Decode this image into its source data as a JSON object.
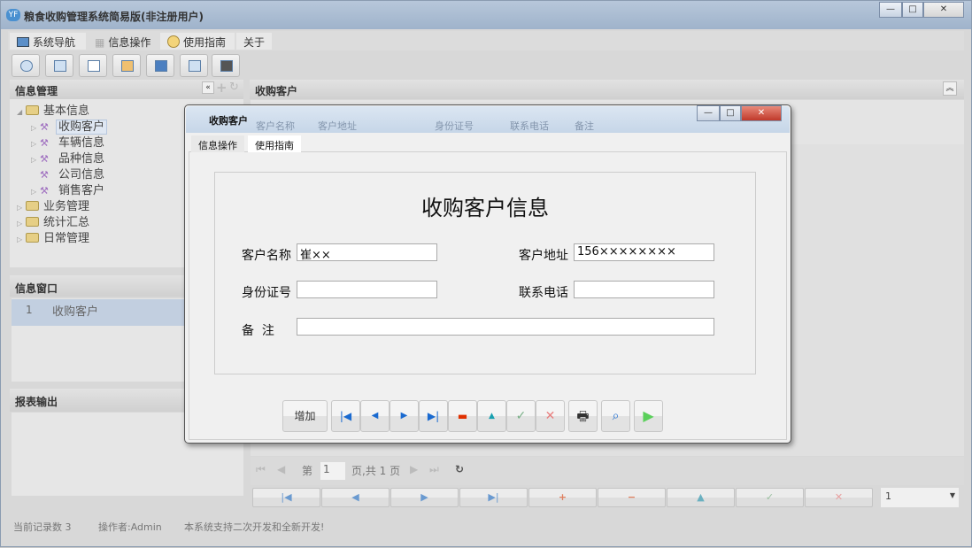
{
  "app": {
    "title": "粮食收购管理系统简易版(非注册用户)",
    "logo": "YF"
  },
  "menu": [
    {
      "label": "系统导航",
      "icon": "monitor-icon"
    },
    {
      "label": "信息操作",
      "icon": "grid-icon"
    },
    {
      "label": "使用指南",
      "icon": "help-icon"
    },
    {
      "label": "关于"
    }
  ],
  "toolbar": [
    "search-icon",
    "list-icon",
    "document-icon",
    "user-icon",
    "screen-icon",
    "export-icon",
    "window-icon"
  ],
  "left": {
    "info_header": "信息管理",
    "tree": [
      {
        "label": "基本信息",
        "children": [
          "收购客户",
          "车辆信息",
          "品种信息",
          "公司信息",
          "销售客户"
        ]
      },
      {
        "label": "业务管理"
      },
      {
        "label": "统计汇总"
      },
      {
        "label": "日常管理"
      }
    ],
    "window_header": "信息窗口",
    "window_rows": [
      {
        "no": "1",
        "name": "收购客户"
      }
    ],
    "report_header": "报表输出"
  },
  "main": {
    "header": "收购客户",
    "bg_columns": [
      "客户名称",
      "客户地址",
      "身份证号",
      "联系电话",
      "备注"
    ],
    "pager": {
      "page_prefix": "第",
      "page": "1",
      "page_suffix": "页,共 1 页"
    },
    "record_select": "1"
  },
  "dialog": {
    "title": "收购客户",
    "tabs": [
      "信息操作",
      "使用指南"
    ],
    "heading": "收购客户信息",
    "fields": {
      "name_label": "客户名称",
      "name_value": "崔××",
      "address_label": "客户地址",
      "address_value": "156××××××××",
      "id_label": "身份证号",
      "id_value": "",
      "phone_label": "联系电话",
      "phone_value": "",
      "note_label": "备  注",
      "note_value": ""
    },
    "add_label": "增加"
  },
  "status": {
    "records": "当前记录数 3",
    "operator": "操作者:Admin",
    "message": "本系统支持二次开发和全新开发!"
  }
}
